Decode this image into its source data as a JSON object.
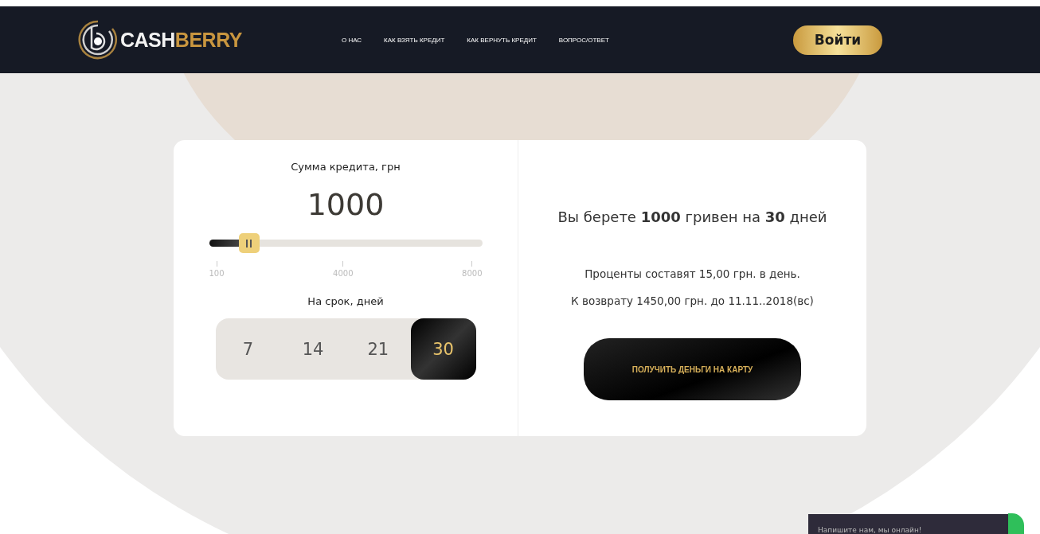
{
  "header": {
    "logo": {
      "part_1": "CASH",
      "part_2": "BERRY"
    },
    "nav": [
      {
        "label": "О НАС"
      },
      {
        "label": "КАК ВЗЯТЬ КРЕДИТ"
      },
      {
        "label": "КАК ВЕРНУТЬ КРЕДИТ"
      },
      {
        "label": "ВОПРОС/ОТВЕТ"
      }
    ],
    "login_button": "Войти"
  },
  "calculator": {
    "amount_label": "Сумма кредита, грн",
    "amount": "1000",
    "slider": {
      "level": 0.146,
      "ticks": [
        "100",
        "4000",
        "8000"
      ]
    },
    "term_label": "На срок, дней",
    "terms": [
      {
        "label": "7",
        "selected": false
      },
      {
        "label": "14",
        "selected": false
      },
      {
        "label": "21",
        "selected": false
      },
      {
        "label": "30",
        "selected": true
      }
    ]
  },
  "summary": {
    "headline": "Вы берете **1000** гривен на **30** дней",
    "interest": "Проценты составят 15,00 грн. в день.",
    "repayment": "К возврату 1450,00 грн. до 11.11..2018(вс)",
    "button": "ПОЛУЧИТЬ ДЕНЬГИ НА КАРТУ"
  },
  "chat": {
    "text": "Напишите нам, мы онлайн!"
  }
}
